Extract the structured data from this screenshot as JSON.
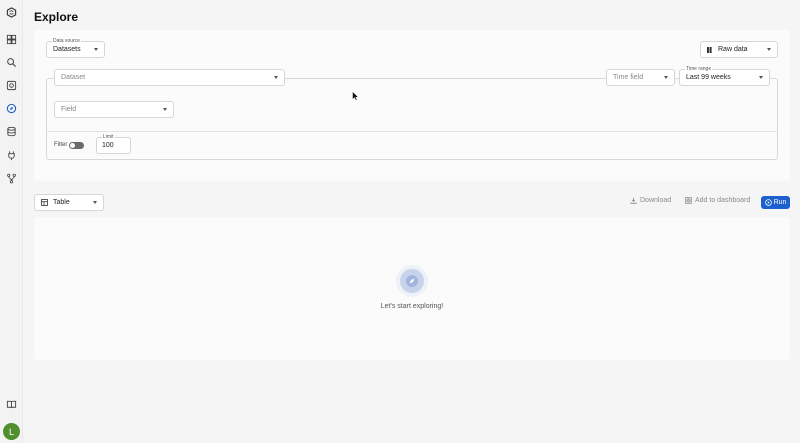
{
  "page": {
    "title": "Explore"
  },
  "sidebar": {
    "icons": [
      "logo-icon",
      "dashboard-icon",
      "search-icon",
      "grid-icon",
      "explore-icon",
      "database-icon",
      "plug-icon",
      "flow-icon",
      "book-icon"
    ],
    "avatar_letter": "L",
    "avatar_color": "#4f8f2e"
  },
  "query": {
    "data_source": {
      "label": "Data source",
      "value": "Datasets"
    },
    "view_mode": {
      "value": "Raw data"
    },
    "dataset": {
      "placeholder": "Dataset"
    },
    "time_field": {
      "placeholder": "Time field"
    },
    "time_range": {
      "label": "Time range",
      "value": "Last 99 weeks"
    },
    "field": {
      "placeholder": "Field"
    },
    "filter": {
      "label": "Filter",
      "enabled": false
    },
    "limit": {
      "label": "Limit",
      "value": "100"
    }
  },
  "results": {
    "view_select": {
      "value": "Table"
    },
    "download_label": "Download",
    "add_dashboard_label": "Add to dashboard",
    "run_label": "Run",
    "empty_text": "Let's start exploring!"
  },
  "colors": {
    "accent": "#1d5fcc"
  }
}
